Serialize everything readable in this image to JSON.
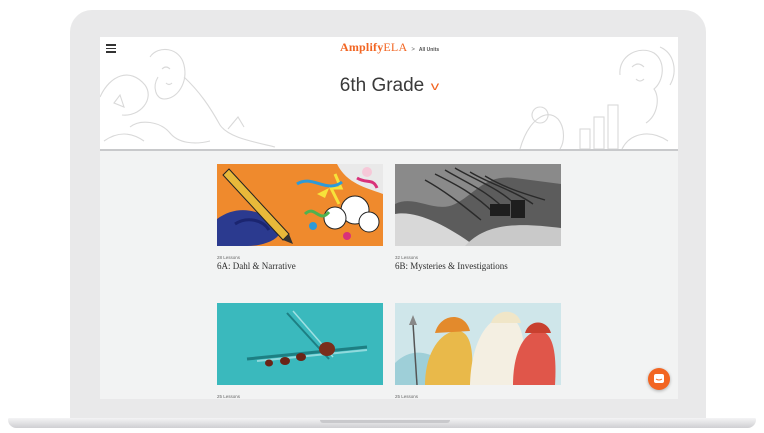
{
  "header": {
    "logo_bold": "Amplify",
    "logo_light": "ELA",
    "breadcrumb_sep": ">",
    "breadcrumb": "All Units",
    "title": "6th Grade",
    "title_chevron": "v"
  },
  "units": [
    {
      "count": "28 Lessons",
      "name": "6A: Dahl & Narrative"
    },
    {
      "count": "32 Lessons",
      "name": "6B: Mysteries & Investigations"
    },
    {
      "count": "25 Lessons",
      "name": ""
    },
    {
      "count": "25 Lessons",
      "name": ""
    }
  ],
  "icons": {
    "menu": "hamburger-menu-icon",
    "title_toggle": "chevron-down-icon",
    "support": "chat-bubble-icon"
  },
  "colors": {
    "brand_orange": "#f26522",
    "header_bg": "#ffffff",
    "content_bg": "#f2f3f3"
  }
}
